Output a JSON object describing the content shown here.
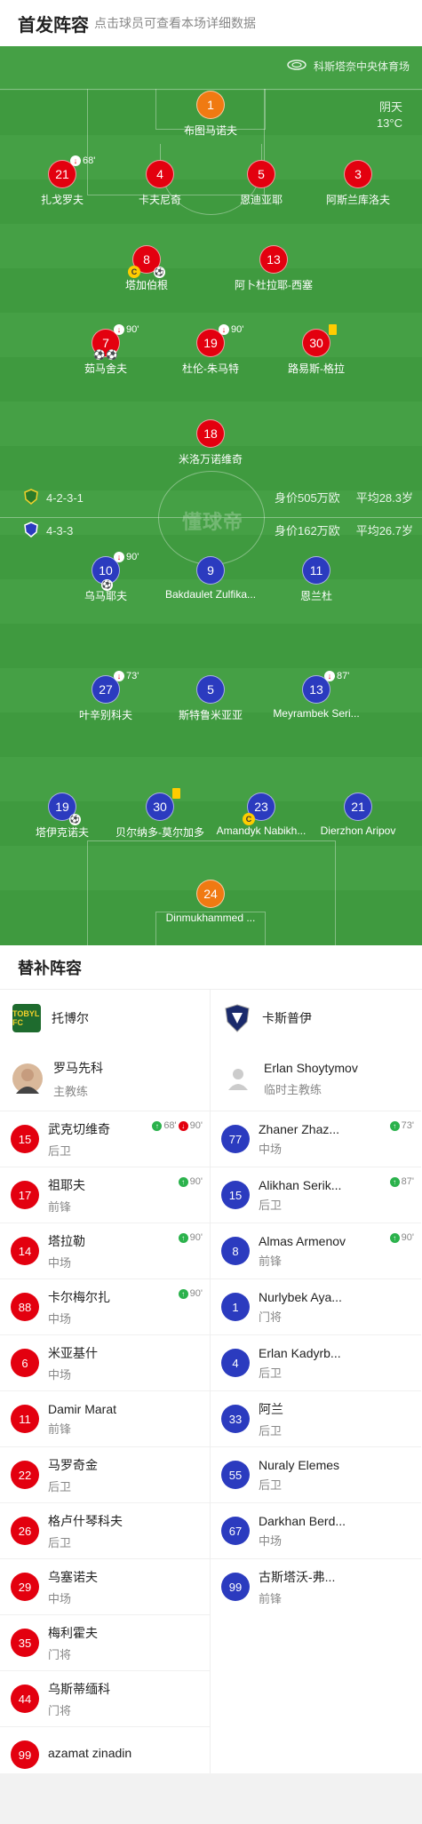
{
  "header": {
    "title": "首发阵容",
    "hint": "点击球员可查看本场详细数据"
  },
  "venue": "科斯塔奈中央体育场",
  "weather": {
    "condition": "阴天",
    "temp": "13°C"
  },
  "watermark": "懂球帝",
  "home": {
    "formation": "4-2-3-1",
    "value": "身价505万欧",
    "age": "平均28.3岁",
    "color": "#e3000f",
    "gk": {
      "num": "1",
      "name": "布图马诺夫"
    },
    "players": [
      {
        "num": "21",
        "name": "扎戈罗夫",
        "event": "68'"
      },
      {
        "num": "4",
        "name": "卡夫尼奇"
      },
      {
        "num": "5",
        "name": "恩迪亚耶"
      },
      {
        "num": "3",
        "name": "阿斯兰库洛夫"
      },
      {
        "num": "8",
        "name": "塔加伯根"
      },
      {
        "num": "13",
        "name": "阿卜杜拉耶-西塞"
      },
      {
        "num": "7",
        "name": "茹马舍夫",
        "event": "90'"
      },
      {
        "num": "19",
        "name": "杜伦-朱马特",
        "event": "90'"
      },
      {
        "num": "30",
        "name": "路易斯-格拉"
      },
      {
        "num": "18",
        "name": "米洛万诺维奇"
      }
    ]
  },
  "away": {
    "formation": "4-3-3",
    "value": "身价162万欧",
    "age": "平均26.7岁",
    "color": "#2b3bbf",
    "gk": {
      "num": "24",
      "name": "Dinmukhammed ..."
    },
    "players": [
      {
        "num": "10",
        "name": "乌马耶夫",
        "event": "90'"
      },
      {
        "num": "9",
        "name": "Bakdaulet Zulfika..."
      },
      {
        "num": "11",
        "name": "恩兰杜"
      },
      {
        "num": "27",
        "name": "叶辛别科夫",
        "event": "73'"
      },
      {
        "num": "5",
        "name": "斯特鲁米亚亚"
      },
      {
        "num": "13",
        "name": "Meyrambek Seri...",
        "event": "87'"
      },
      {
        "num": "19",
        "name": "塔伊克诺夫"
      },
      {
        "num": "30",
        "name": "贝尔纳多-莫尔加多"
      },
      {
        "num": "23",
        "name": "Amandyk Nabikh..."
      },
      {
        "num": "21",
        "name": "Dierzhon Aripov"
      }
    ]
  },
  "subs": {
    "title": "替补阵容",
    "home": {
      "team": "托博尔",
      "logo_text": "TOBYL FC",
      "coach": {
        "name": "罗马先科",
        "role": "主教练"
      },
      "list": [
        {
          "num": "15",
          "name": "武克切维奇",
          "pos": "后卫",
          "in": "68'",
          "out": "90'"
        },
        {
          "num": "17",
          "name": "祖耶夫",
          "pos": "前锋",
          "in": "90'"
        },
        {
          "num": "14",
          "name": "塔拉勒",
          "pos": "中场",
          "in": "90'"
        },
        {
          "num": "88",
          "name": "卡尔梅尔扎",
          "pos": "中场",
          "in": "90'"
        },
        {
          "num": "6",
          "name": "米亚基什",
          "pos": "中场"
        },
        {
          "num": "11",
          "name": "Damir Marat",
          "pos": "前锋"
        },
        {
          "num": "22",
          "name": "马罗奇金",
          "pos": "后卫"
        },
        {
          "num": "26",
          "name": "格卢什琴科夫",
          "pos": "后卫"
        },
        {
          "num": "29",
          "name": "乌塞诺夫",
          "pos": "中场"
        },
        {
          "num": "35",
          "name": "梅利霍夫",
          "pos": "门将"
        },
        {
          "num": "44",
          "name": "乌斯蒂缅科",
          "pos": "门将"
        },
        {
          "num": "99",
          "name": "azamat zinadin",
          "pos": ""
        }
      ]
    },
    "away": {
      "team": "卡斯普伊",
      "coach": {
        "name": "Erlan Shoytymov",
        "role": "临时主教练"
      },
      "list": [
        {
          "num": "77",
          "name": "Zhaner Zhaz...",
          "pos": "中场",
          "in": "73'"
        },
        {
          "num": "15",
          "name": "Alikhan Serik...",
          "pos": "后卫",
          "in": "87'"
        },
        {
          "num": "8",
          "name": "Almas Armenov",
          "pos": "前锋",
          "in": "90'"
        },
        {
          "num": "1",
          "name": "Nurlybek Aya...",
          "pos": "门将"
        },
        {
          "num": "4",
          "name": "Erlan Kadyrb...",
          "pos": "后卫"
        },
        {
          "num": "33",
          "name": "阿兰",
          "pos": "后卫"
        },
        {
          "num": "55",
          "name": "Nuraly Elemes",
          "pos": "后卫"
        },
        {
          "num": "67",
          "name": "Darkhan Berd...",
          "pos": "中场"
        },
        {
          "num": "99",
          "name": "古斯塔沃-弗...",
          "pos": "前锋"
        }
      ]
    }
  }
}
